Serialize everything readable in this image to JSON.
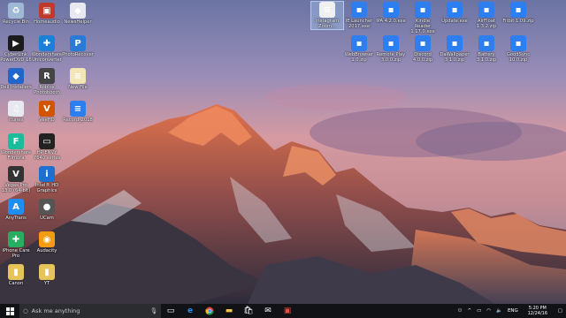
{
  "desktop": {
    "icons": [
      {
        "label": "Recycle Bin",
        "icon": "recycle-bin-icon",
        "color": "#9fb8d6",
        "glyph": "♻"
      },
      {
        "label": "Homeaudio",
        "icon": "game-icon",
        "color": "#c0392b",
        "glyph": "▣"
      },
      {
        "label": "NewsHelper",
        "icon": "shield-icon",
        "color": "#e8e8f0",
        "glyph": "◆"
      },
      {
        "label": "CyberLink PowerDVD 16",
        "icon": "powerdvd-icon",
        "color": "#1b1b1b",
        "glyph": "▶"
      },
      {
        "label": "Wondershare Uniconverter",
        "icon": "wondershare-icon",
        "color": "#1e7fd6",
        "glyph": "✚"
      },
      {
        "label": "PhotoRecover",
        "icon": "photorecover-icon",
        "color": "#2a7bd8",
        "glyph": "P"
      },
      {
        "label": "Dell Installers",
        "icon": "dell-icon",
        "color": "#2366c9",
        "glyph": "◆"
      },
      {
        "label": "Roblox Photobooth",
        "icon": "roblox-icon",
        "color": "#444",
        "glyph": "R"
      },
      {
        "label": "New File",
        "icon": "file-icon",
        "color": "#f3e6b7",
        "glyph": "≡"
      },
      {
        "label": "iTunes",
        "icon": "itunes-icon",
        "color": "#e8e8f0",
        "glyph": "♫"
      },
      {
        "label": "VeeHD",
        "icon": "veehd-icon",
        "color": "#d35400",
        "glyph": "V"
      },
      {
        "label": "Record_2018",
        "icon": "record-icon",
        "color": "#2d7ff0",
        "glyph": "≡"
      },
      {
        "label": "Wondershare Filmora",
        "icon": "filmora-icon",
        "color": "#1abc9c",
        "glyph": "F"
      },
      {
        "label": "HP ENVY 7640 series",
        "icon": "printer-icon",
        "color": "#222",
        "glyph": "▭"
      },
      {
        "label": "Vegas Pro 13.0 (64-bit)",
        "icon": "vegas-icon",
        "color": "#333",
        "glyph": "V"
      },
      {
        "label": "Intel® HD Graphics",
        "icon": "intel-icon",
        "color": "#1d6fd0",
        "glyph": "i"
      },
      {
        "label": "AnyTrans",
        "icon": "anytrans-icon",
        "color": "#1f8ef1",
        "glyph": "A"
      },
      {
        "label": "UCam",
        "icon": "ucam-icon",
        "color": "#555",
        "glyph": "●"
      },
      {
        "label": "iPhone Care Pro",
        "icon": "iphonecare-icon",
        "color": "#27ae60",
        "glyph": "✚"
      },
      {
        "label": "Audacity",
        "icon": "audacity-icon",
        "color": "#f39c12",
        "glyph": "◉"
      },
      {
        "label": "Canon",
        "icon": "folder-icon",
        "color": "#e6c45a",
        "glyph": "▮"
      },
      {
        "label": "YT",
        "icon": "folder-icon",
        "color": "#e6c45a",
        "glyph": "▮"
      }
    ],
    "top_icons": [
      {
        "label": "Instagram Zoom...",
        "icon": "file-icon",
        "color": "#f0f0f0",
        "glyph": "≡",
        "selected": true
      },
      {
        "label": "IE Launcher 2017.exe",
        "icon": "exe-icon",
        "color": "#2d7ff0",
        "glyph": "▪"
      },
      {
        "label": "IPA 4.2.0.exe",
        "icon": "exe-icon",
        "color": "#2d7ff0",
        "glyph": "▪"
      },
      {
        "label": "Kindle Reader 1.17.0.exe",
        "icon": "exe-icon",
        "color": "#2d7ff0",
        "glyph": "▪"
      },
      {
        "label": "Update.exe",
        "icon": "exe-icon",
        "color": "#2d7ff0",
        "glyph": "▪"
      },
      {
        "label": "AirFloat 1.3.2.zip",
        "icon": "exe-icon",
        "color": "#2d7ff0",
        "glyph": "▪"
      },
      {
        "label": "Fitbit 1.09.zip",
        "icon": "exe-icon",
        "color": "#2d7ff0",
        "glyph": "▪"
      },
      {
        "label": "WebBrowser 1.0.zip",
        "icon": "exe-icon",
        "color": "#2d7ff0",
        "glyph": "▪"
      },
      {
        "label": "Remote Play 3.0.0.zip",
        "icon": "exe-icon",
        "color": "#2d7ff0",
        "glyph": "▪"
      },
      {
        "label": "Discord 4.0.0.zip",
        "icon": "exe-icon",
        "color": "#2d7ff0",
        "glyph": "▪"
      },
      {
        "label": "DaWallpaper 3.1.0.zip",
        "icon": "exe-icon",
        "color": "#2d7ff0",
        "glyph": "▪"
      },
      {
        "label": "Battery 3.1.0.zip",
        "icon": "exe-icon",
        "color": "#2d7ff0",
        "glyph": "▪"
      },
      {
        "label": "GoodSync 10.0.zip",
        "icon": "exe-icon",
        "color": "#2d7ff0",
        "glyph": "▪"
      }
    ]
  },
  "taskbar": {
    "search_placeholder": "Ask me anything",
    "language": "ENG",
    "time": "5:20 PM",
    "date": "12/24/16"
  },
  "colors": {
    "taskbar_bg": "#101216",
    "accent": "#2d7ff0"
  }
}
